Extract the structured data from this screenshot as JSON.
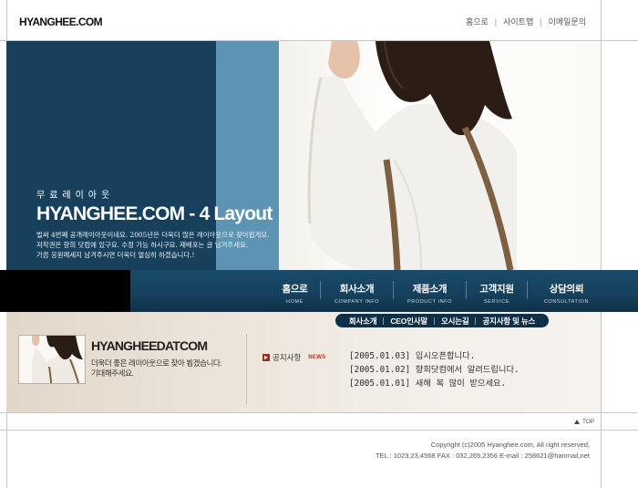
{
  "header": {
    "logo": "HYANGHEE.COM",
    "util_links": [
      "홈으로",
      "사이트맵",
      "이메일문의"
    ]
  },
  "hero": {
    "subtitle": "무료레이아웃",
    "title": "HYANGHEE.COM - 4 Layout",
    "description_lines": [
      "벌써 4번째 공개레이아웃이네요. 2005년은 더욱더 많은 레이아웃으로 찾아뵙게요.",
      "저작권은 향희 닷컴에 있구요. 수정 가능 하시구요. 재배포는 글 남겨주세요.",
      "가끔 응원메세지 남겨주시면 더욱더 열심히 하겠습니다.!"
    ]
  },
  "nav": {
    "items": [
      {
        "ko": "홈으로",
        "en": "HOME"
      },
      {
        "ko": "회사소개",
        "en": "COMPANY INFO"
      },
      {
        "ko": "제품소개",
        "en": "PRODUCT INFO"
      },
      {
        "ko": "고객지원",
        "en": "SERVICE"
      },
      {
        "ko": "상담의뢰",
        "en": "CONSULTATION"
      }
    ]
  },
  "subnav": {
    "items": [
      "회사소개",
      "CEO인사말",
      "오시는길",
      "공지사항 및 뉴스"
    ]
  },
  "intro": {
    "site_name": "HYANGHEEDATCOM",
    "desc_lines": [
      "더욱더 좋은 레이아웃으로 찾아 뵙겠습니다.",
      "기대해주세요."
    ]
  },
  "news": {
    "label": "공지사항",
    "tag": "NEWS",
    "items": [
      {
        "date": "[2005.01.03]",
        "title": "입시오픈합니다."
      },
      {
        "date": "[2005.01.02]",
        "title": "향희닷컴에서 알려드립니다."
      },
      {
        "date": "[2005.01.01]",
        "title": "새해 복 많이 받으세요."
      }
    ]
  },
  "footer": {
    "top_label": "TOP",
    "copyright": "Copyright (c)2005 Hyanghee.com, All right reserved,",
    "contact": "TEL : 1023,23,4568   FAX : 032,265,2356   E-mail : 258621@hanmail,net"
  },
  "colors": {
    "hero_dark": "#17405c",
    "hero_mid": "#5d93b3",
    "nav_bg": "#16415d",
    "news_accent": "#c42a21"
  }
}
